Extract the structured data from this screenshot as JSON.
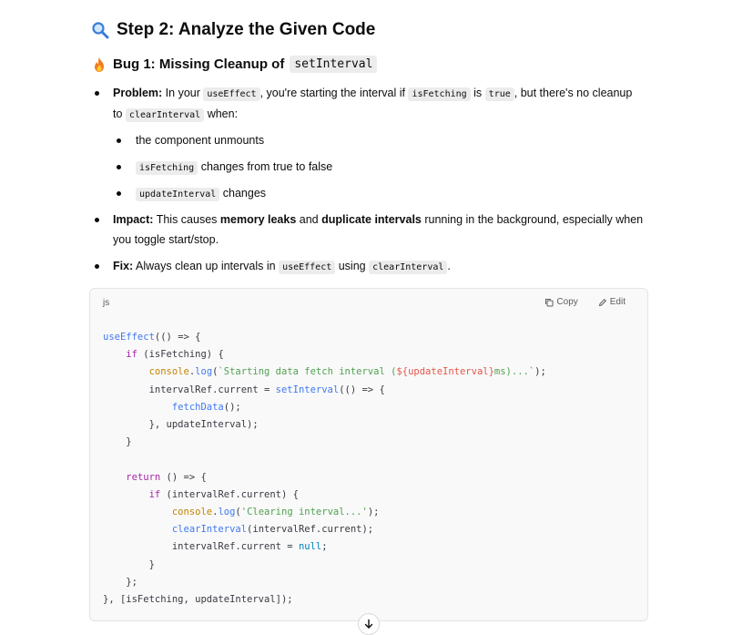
{
  "heading": {
    "title": "Step 2: Analyze the Given Code",
    "icon": "magnifier-icon"
  },
  "bug": {
    "title": "Bug 1: Missing Cleanup of",
    "code": "setInterval",
    "icon": "fire-icon"
  },
  "problem": {
    "label": "Problem:",
    "t1": "In your",
    "c1": "useEffect",
    "t2": ", you're starting the interval if",
    "c2": "isFetching",
    "t3": "is",
    "c3": "true",
    "t4": ", but there's no cleanup",
    "t5": "to",
    "c4": "clearInterval",
    "t6": "when:"
  },
  "sub_items": [
    {
      "text": "the component unmounts"
    },
    {
      "code": "isFetching",
      "text": "changes from true to false"
    },
    {
      "code": "updateInterval",
      "text": "changes"
    }
  ],
  "impact": {
    "label": "Impact:",
    "t1": "This causes",
    "b1": "memory leaks",
    "t2": "and",
    "b2": "duplicate intervals",
    "t3": "running in the background, especially when",
    "t4": "you toggle start/stop."
  },
  "fix": {
    "label": "Fix:",
    "t1": "Always clean up intervals in",
    "c1": "useEffect",
    "t2": "using",
    "c2": "clearInterval",
    "t3": "."
  },
  "code_block": {
    "language": "js",
    "copy_label": "Copy",
    "edit_label": "Edit",
    "lines": [
      "useEffect(() => {",
      "    if (isFetching) {",
      "        console.log(`Starting data fetch interval (${updateInterval}ms)...`);",
      "        intervalRef.current = setInterval(() => {",
      "            fetchData();",
      "        }, updateInterval);",
      "    }",
      "",
      "    return () => {",
      "        if (intervalRef.current) {",
      "            console.log('Clearing interval...');",
      "            clearInterval(intervalRef.current);",
      "            intervalRef.current = null;",
      "        }",
      "    };",
      "}, [isFetching, updateInterval]);"
    ]
  },
  "colors": {
    "keyword": "#a626a4",
    "function": "#4078f2",
    "string": "#50a14f",
    "object": "#c18401",
    "literal": "#0184bc"
  }
}
